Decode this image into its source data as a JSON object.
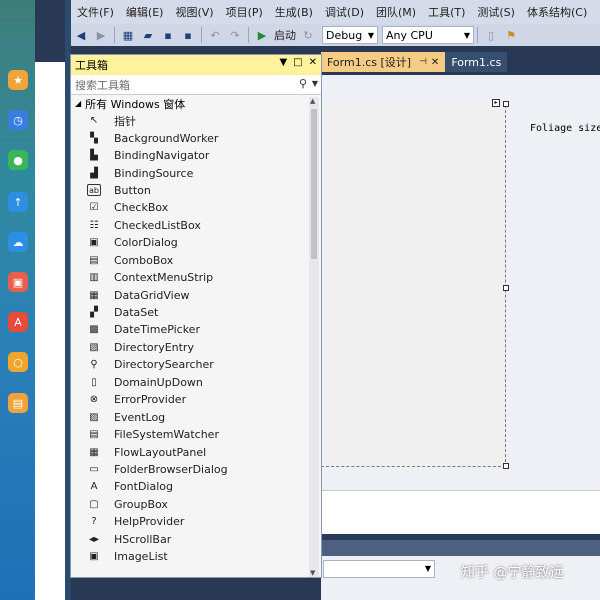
{
  "menu": [
    "文件(F)",
    "编辑(E)",
    "视图(V)",
    "项目(P)",
    "生成(B)",
    "调试(D)",
    "团队(M)",
    "工具(T)",
    "测试(S)",
    "体系结构(C)"
  ],
  "toolbar": {
    "start_label": "启动",
    "config_value": "Debug",
    "platform_value": "Any CPU"
  },
  "document_tabs": [
    {
      "label": "Form1.cs [设计]",
      "active": true
    },
    {
      "label": "Form1.cs",
      "active": false
    }
  ],
  "designer": {
    "label_text": "Foliage size"
  },
  "watermark": "知乎 @宁静致远",
  "toolbox": {
    "title": "工具箱",
    "search_placeholder": "搜索工具箱",
    "group": "所有 Windows 窗体",
    "items": [
      {
        "label": "指针",
        "icon": "pointer-icon"
      },
      {
        "label": "BackgroundWorker",
        "icon": "backgroundworker-icon"
      },
      {
        "label": "BindingNavigator",
        "icon": "bindingnavigator-icon"
      },
      {
        "label": "BindingSource",
        "icon": "bindingsource-icon"
      },
      {
        "label": "Button",
        "icon": "button-icon"
      },
      {
        "label": "CheckBox",
        "icon": "checkbox-icon"
      },
      {
        "label": "CheckedListBox",
        "icon": "checkedlistbox-icon"
      },
      {
        "label": "ColorDialog",
        "icon": "colordialog-icon"
      },
      {
        "label": "ComboBox",
        "icon": "combobox-icon"
      },
      {
        "label": "ContextMenuStrip",
        "icon": "contextmenustrip-icon"
      },
      {
        "label": "DataGridView",
        "icon": "datagridview-icon"
      },
      {
        "label": "DataSet",
        "icon": "dataset-icon"
      },
      {
        "label": "DateTimePicker",
        "icon": "datetimepicker-icon"
      },
      {
        "label": "DirectoryEntry",
        "icon": "directoryentry-icon"
      },
      {
        "label": "DirectorySearcher",
        "icon": "directorysearcher-icon"
      },
      {
        "label": "DomainUpDown",
        "icon": "domainupdown-icon"
      },
      {
        "label": "ErrorProvider",
        "icon": "errorprovider-icon"
      },
      {
        "label": "EventLog",
        "icon": "eventlog-icon"
      },
      {
        "label": "FileSystemWatcher",
        "icon": "filesystemwatcher-icon"
      },
      {
        "label": "FlowLayoutPanel",
        "icon": "flowlayoutpanel-icon"
      },
      {
        "label": "FolderBrowserDialog",
        "icon": "folderbrowserdialog-icon"
      },
      {
        "label": "FontDialog",
        "icon": "fontdialog-icon"
      },
      {
        "label": "GroupBox",
        "icon": "groupbox-icon"
      },
      {
        "label": "HelpProvider",
        "icon": "helpprovider-icon"
      },
      {
        "label": "HScrollBar",
        "icon": "hscrollbar-icon"
      },
      {
        "label": "ImageList",
        "icon": "imagelist-icon"
      }
    ]
  },
  "launcher_icons": [
    "star-icon",
    "clock-icon",
    "chat-icon",
    "share-icon",
    "cloud-icon",
    "photo-icon",
    "pdf-icon",
    "search-icon",
    "folder-icon"
  ],
  "colors": {
    "toolbox_title_bg": "#fff29d",
    "active_tab_bg": "#f5cc84",
    "ide_background": "#293955"
  }
}
